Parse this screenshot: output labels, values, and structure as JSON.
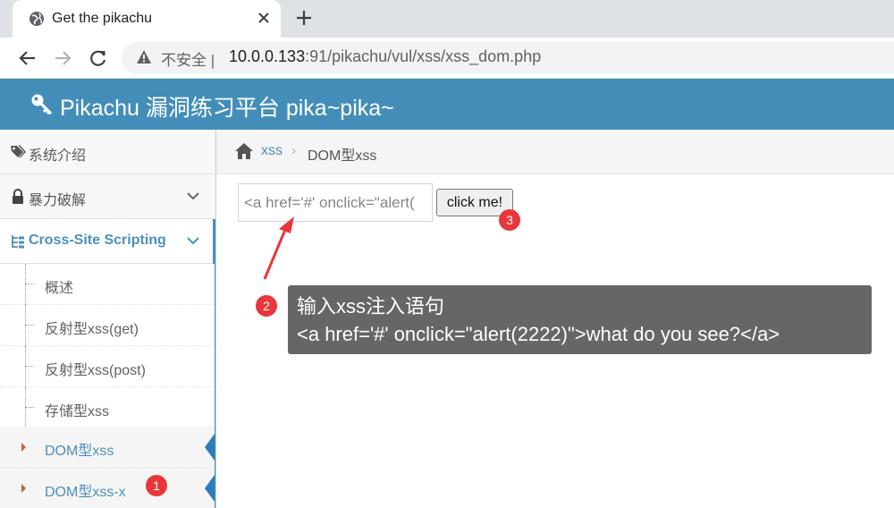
{
  "browser": {
    "tab_title": "Get the pikachu",
    "security_label": "不安全",
    "url_host": "10.0.0.133",
    "url_rest": ":91/pikachu/vul/xss/xss_dom.php"
  },
  "header": {
    "title": "Pikachu 漏洞练习平台 pika~pika~"
  },
  "sidebar": {
    "items": [
      {
        "label": "系统介绍",
        "icon": "tags-icon"
      },
      {
        "label": "暴力破解",
        "icon": "lock-icon"
      },
      {
        "label": "Cross-Site Scripting",
        "icon": "tree-icon"
      }
    ],
    "subitems": [
      {
        "label": "概述"
      },
      {
        "label": "反射型xss(get)"
      },
      {
        "label": "反射型xss(post)"
      },
      {
        "label": "存储型xss"
      },
      {
        "label": "DOM型xss"
      },
      {
        "label": "DOM型xss-x"
      }
    ]
  },
  "breadcrumb": {
    "link": "xss",
    "current": "DOM型xss"
  },
  "main": {
    "input_value": "<a href='#' onclick=\"alert(",
    "button_label": "click me!"
  },
  "annotations": {
    "badge1": "1",
    "badge2": "2",
    "badge3": "3",
    "tooltip_line1": "输入xss注入语句",
    "tooltip_line2": "<a href='#' onclick=\"alert(2222)\">what do you see?</a>"
  },
  "colors": {
    "header_bg": "#438eb9",
    "accent": "#4c8fbd",
    "badge": "#e8373c",
    "tooltip_bg": "#666666"
  }
}
